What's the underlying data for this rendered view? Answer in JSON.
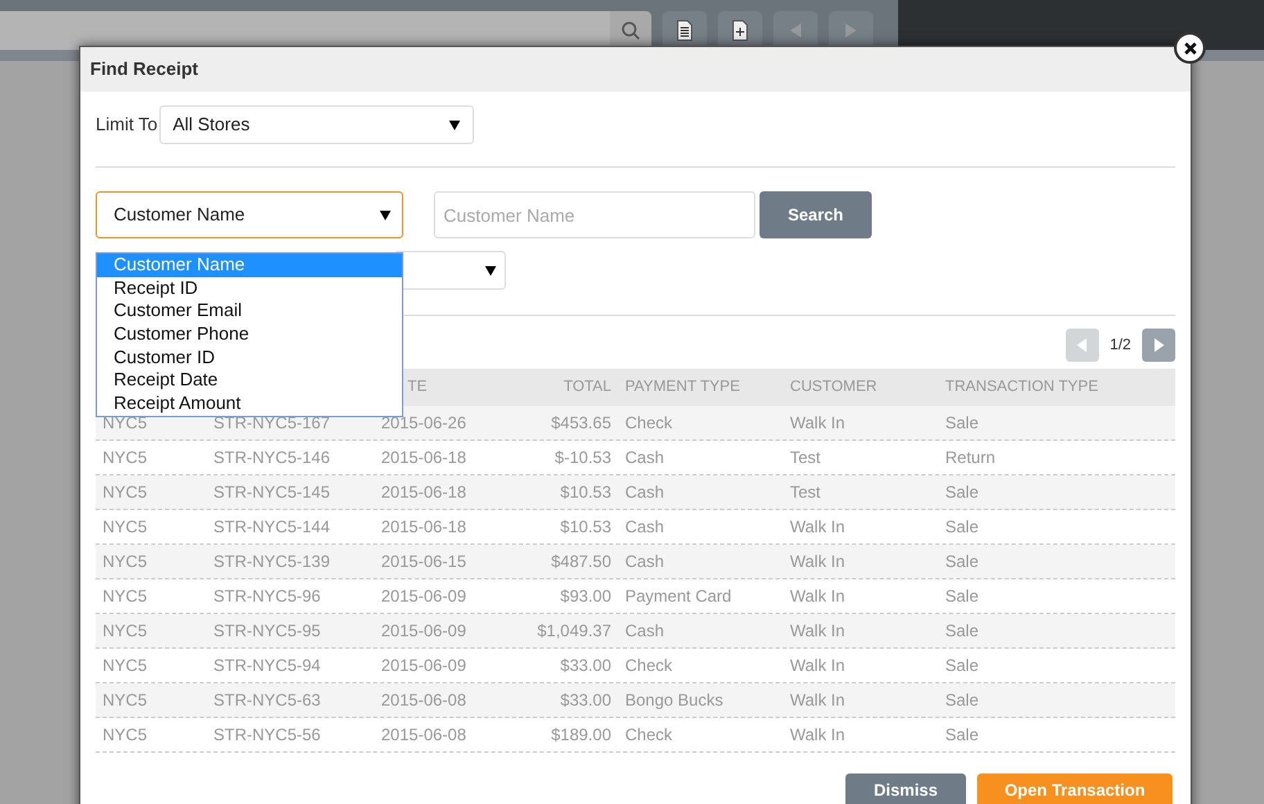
{
  "dialog": {
    "title": "Find Receipt"
  },
  "limit": {
    "label": "Limit To",
    "value": "All Stores"
  },
  "search": {
    "field_value": "Customer Name",
    "placeholder": "Customer Name",
    "button": "Search",
    "options": [
      {
        "label": "Customer Name",
        "selected": true
      },
      {
        "label": "Receipt ID",
        "selected": false
      },
      {
        "label": "Customer Email",
        "selected": false
      },
      {
        "label": "Customer Phone",
        "selected": false
      },
      {
        "label": "Customer ID",
        "selected": false
      },
      {
        "label": "Receipt Date",
        "selected": false
      },
      {
        "label": "Receipt Amount",
        "selected": false
      }
    ]
  },
  "pagination": {
    "page": "1/2",
    "prev_disabled": true,
    "next_disabled": false
  },
  "table": {
    "columns": [
      "",
      "",
      "TE",
      "TOTAL",
      "PAYMENT TYPE",
      "CUSTOMER",
      "TRANSACTION TYPE"
    ],
    "rows": [
      [
        "NYC5",
        "STR-NYC5-167",
        "2015-06-26",
        "$453.65",
        "Check",
        "Walk In",
        "Sale"
      ],
      [
        "NYC5",
        "STR-NYC5-146",
        "2015-06-18",
        "$-10.53",
        "Cash",
        "Test",
        "Return"
      ],
      [
        "NYC5",
        "STR-NYC5-145",
        "2015-06-18",
        "$10.53",
        "Cash",
        "Test",
        "Sale"
      ],
      [
        "NYC5",
        "STR-NYC5-144",
        "2015-06-18",
        "$10.53",
        "Cash",
        "Walk In",
        "Sale"
      ],
      [
        "NYC5",
        "STR-NYC5-139",
        "2015-06-15",
        "$487.50",
        "Cash",
        "Walk In",
        "Sale"
      ],
      [
        "NYC5",
        "STR-NYC5-96",
        "2015-06-09",
        "$93.00",
        "Payment Card",
        "Walk In",
        "Sale"
      ],
      [
        "NYC5",
        "STR-NYC5-95",
        "2015-06-09",
        "$1,049.37",
        "Cash",
        "Walk In",
        "Sale"
      ],
      [
        "NYC5",
        "STR-NYC5-94",
        "2015-06-09",
        "$33.00",
        "Check",
        "Walk In",
        "Sale"
      ],
      [
        "NYC5",
        "STR-NYC5-63",
        "2015-06-08",
        "$33.00",
        "Bongo Bucks",
        "Walk In",
        "Sale"
      ],
      [
        "NYC5",
        "STR-NYC5-56",
        "2015-06-08",
        "$189.00",
        "Check",
        "Walk In",
        "Sale"
      ]
    ]
  },
  "buttons": [
    "Dismiss",
    "Open Transaction"
  ]
}
